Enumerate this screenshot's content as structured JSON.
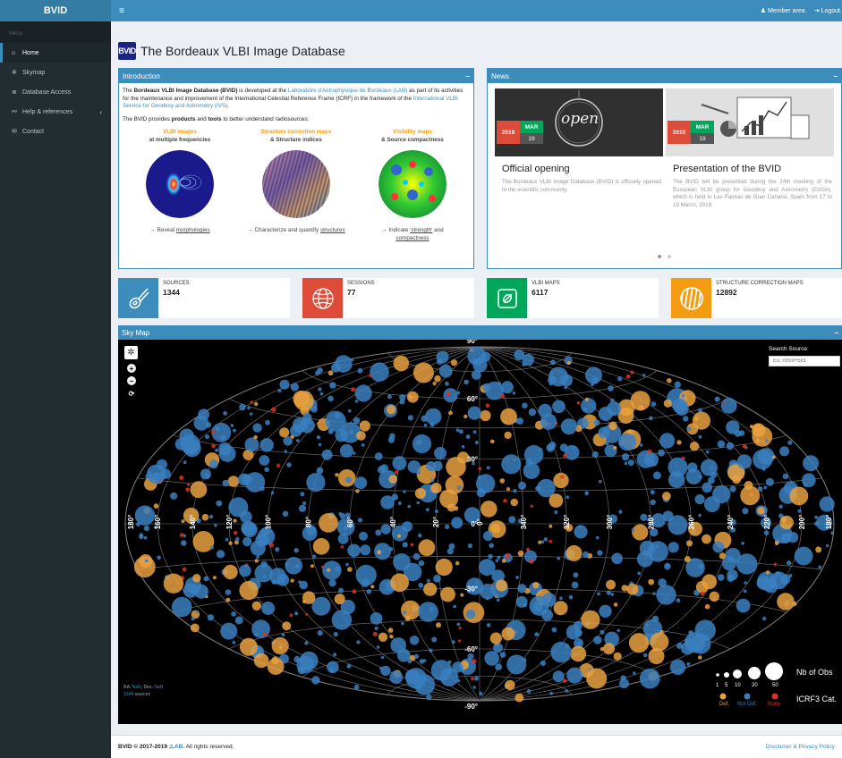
{
  "app": {
    "brand": "BVID",
    "menu_header": "Menu",
    "logo_text": "BVID",
    "title": "The Bordeaux VLBI Image Database"
  },
  "sidebar": {
    "items": [
      {
        "label": "Home",
        "icon": "home-icon",
        "active": true
      },
      {
        "label": "Skymap",
        "icon": "gear-icon"
      },
      {
        "label": "Database Access",
        "icon": "database-icon"
      },
      {
        "label": "Help & references",
        "icon": "link-icon",
        "chevron": "‹"
      },
      {
        "label": "Contact",
        "icon": "envelope-icon"
      }
    ]
  },
  "topbar": {
    "toggle": "≡",
    "member": "Member area",
    "logout": "Logout"
  },
  "intro": {
    "title": "Introduction",
    "collapse": "−",
    "p1_a": "The ",
    "p1_b": "Bordeaux VLBI Image Database (BVID)",
    "p1_c": " is developed at the ",
    "p1_link1": "Laboratoire d'Astrophysique de Bordeaux (LAB)",
    "p1_d": " as part of its activities for the maintenance and improvement of the International Celestial Reference Frame (ICRF) in the framework of the ",
    "p1_link2": "International VLBI Service for Geodesy and Astrometry (IVS)",
    "p1_e": ".",
    "p2_a": "The BVID provides ",
    "p2_b": "products",
    "p2_c": " and ",
    "p2_d": "tools",
    "p2_e": " to better understand radiosources:",
    "products": [
      {
        "title": "VLBI images",
        "sub": "at multiple frequencies",
        "desc_pre": "→ Reveal ",
        "desc_link": "morphologies",
        "desc_post": ""
      },
      {
        "title": "Structure correction maps",
        "sub": "& Structure indices",
        "desc_pre": "→ Characterize and quantify ",
        "desc_link": "structures",
        "desc_post": ""
      },
      {
        "title": "Visibility maps",
        "sub": "& Source compactness",
        "desc_pre": "→ Indicate ",
        "desc_link": "'strength'",
        "desc_post": " and ",
        "desc_link2": "compactness"
      }
    ]
  },
  "news": {
    "title": "News",
    "collapse": "−",
    "items": [
      {
        "year": "2019",
        "month": "MAR",
        "day": "19",
        "title": "Official opening",
        "text": "The Bordeaux VLBI Image Database (BVID) is officially opened to the scientific community.",
        "image_word": "open"
      },
      {
        "year": "2019",
        "month": "MAR",
        "day": "19",
        "title": "Presentation of the BVID",
        "text": "The BVID will be presented during the 24th meeting of the European VLBI group for Geodesy and Astrometry (EVGA), which is held in Las Palmas de Gran Canaria, Spain from 17 to 19 March, 2019."
      }
    ]
  },
  "stats": [
    {
      "label": "SOURCES",
      "value": "1344",
      "color": "#3c8dbc"
    },
    {
      "label": "SESSIONS",
      "value": "77",
      "color": "#dd4b39"
    },
    {
      "label": "VLBI MAPS",
      "value": "6117",
      "color": "#00a65a"
    },
    {
      "label": "STRUCTURE CORRECTION MAPS",
      "value": "12892",
      "color": "#f39c12"
    }
  ],
  "skymap": {
    "title": "Sky Map",
    "collapse": "−",
    "search_label": "Search Source:",
    "search_placeholder": "Ex: 0059+581",
    "lat_labels": [
      "90°",
      "60°",
      "30°",
      "0°",
      "-30°",
      "-60°",
      "-90°"
    ],
    "lon_labels": [
      "180°",
      "160°",
      "140°",
      "120°",
      "100°",
      "80°",
      "60°",
      "40°",
      "20°",
      "0°",
      "340°",
      "320°",
      "300°",
      "280°",
      "260°",
      "240°",
      "220°",
      "200°",
      "180°"
    ],
    "status_ra": "RA:",
    "status_ra_val": "NaN",
    "status_dec": ", Dec:",
    "status_dec_val": "NaN",
    "status_count": "1344",
    "status_count_suffix": " sources",
    "legend_nb": "Nb of Obs",
    "legend_sizes": [
      "1",
      "5",
      "10",
      "20",
      "50"
    ],
    "legend_cat": "ICRF3 Cat.",
    "legend_def": "Def.",
    "legend_notdef": "Not Def.",
    "legend_none": "None",
    "colors": {
      "def": "#e8a040",
      "notdef": "#3a7fc0",
      "none": "#e03020"
    }
  },
  "footer": {
    "copy": "BVID © 2017-2019 ; ",
    "lab": "LAB",
    "rights": ". All rights reserved.",
    "right": "Disclamer & Privacy Policy"
  }
}
